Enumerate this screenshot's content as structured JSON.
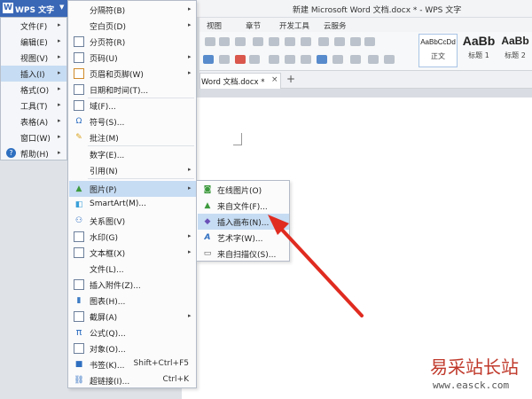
{
  "app": {
    "title": "新建 Microsoft Word 文档.docx * - WPS 文字",
    "wps_button_label": "WPS 文字",
    "wps_logo_letter": "W",
    "ribbon_tabs": [
      "视图",
      "章节",
      "开发工具",
      "云服务"
    ],
    "styles": [
      {
        "sample": "AaBbCcDd",
        "label": "正文"
      },
      {
        "sample": "AaBb",
        "label": "标题 1"
      },
      {
        "sample": "AaBb",
        "label": "标题 2"
      }
    ],
    "doc_tab": {
      "label": "Word 文档.docx *",
      "close": "×",
      "new": "+"
    }
  },
  "main_menu": {
    "items": [
      {
        "label": "文件(F)",
        "arrow": "▸"
      },
      {
        "label": "编辑(E)",
        "arrow": "▸"
      },
      {
        "label": "视图(V)",
        "arrow": "▸"
      },
      {
        "label": "插入(I)",
        "arrow": "▸",
        "active": true
      },
      {
        "label": "格式(O)",
        "arrow": "▸"
      },
      {
        "label": "工具(T)",
        "arrow": "▸"
      },
      {
        "label": "表格(A)",
        "arrow": "▸"
      },
      {
        "label": "窗口(W)",
        "arrow": "▸"
      },
      {
        "label": "帮助(H)",
        "arrow": "▸"
      }
    ]
  },
  "insert_menu": {
    "items": [
      {
        "label": "分隔符(B)",
        "arrow": "▸"
      },
      {
        "label": "空白页(D)",
        "arrow": "▸"
      },
      {
        "label": "分页符(R)"
      },
      {
        "label": "页码(U)",
        "arrow": "▸"
      },
      {
        "label": "页眉和页脚(W)",
        "arrow": "▸"
      },
      {
        "label": "日期和时间(T)..."
      },
      {
        "label": "域(F)..."
      },
      {
        "label": "符号(S)..."
      },
      {
        "label": "批注(M)"
      },
      {
        "label": "数字(E)..."
      },
      {
        "label": "引用(N)",
        "arrow": "▸"
      },
      {
        "label": "图片(P)",
        "arrow": "▸",
        "active": true
      },
      {
        "label": "SmartArt(M)..."
      },
      {
        "label": "关系图(V)"
      },
      {
        "label": "水印(G)",
        "arrow": "▸"
      },
      {
        "label": "文本框(X)",
        "arrow": "▸"
      },
      {
        "label": "文件(L)..."
      },
      {
        "label": "插入附件(Z)..."
      },
      {
        "label": "图表(H)..."
      },
      {
        "label": "截屏(A)",
        "arrow": "▸"
      },
      {
        "label": "公式(Q)..."
      },
      {
        "label": "对象(O)..."
      },
      {
        "label": "书签(K)...",
        "shortcut": "Shift+Ctrl+F5"
      },
      {
        "label": "超链接(I)...",
        "shortcut": "Ctrl+K"
      }
    ]
  },
  "picture_menu": {
    "items": [
      {
        "label": "在线图片(O)"
      },
      {
        "label": "来自文件(F)..."
      },
      {
        "label": "插入画布(N)...",
        "active": true
      },
      {
        "label": "艺术字(W)..."
      },
      {
        "label": "来自扫描仪(S)..."
      }
    ]
  },
  "watermark": {
    "text": "易采站长站",
    "url": "www.easck.com"
  },
  "colors": {
    "accent": "#3a67b6",
    "highlight": "#c6dcf3",
    "arrow": "#e02b20"
  }
}
